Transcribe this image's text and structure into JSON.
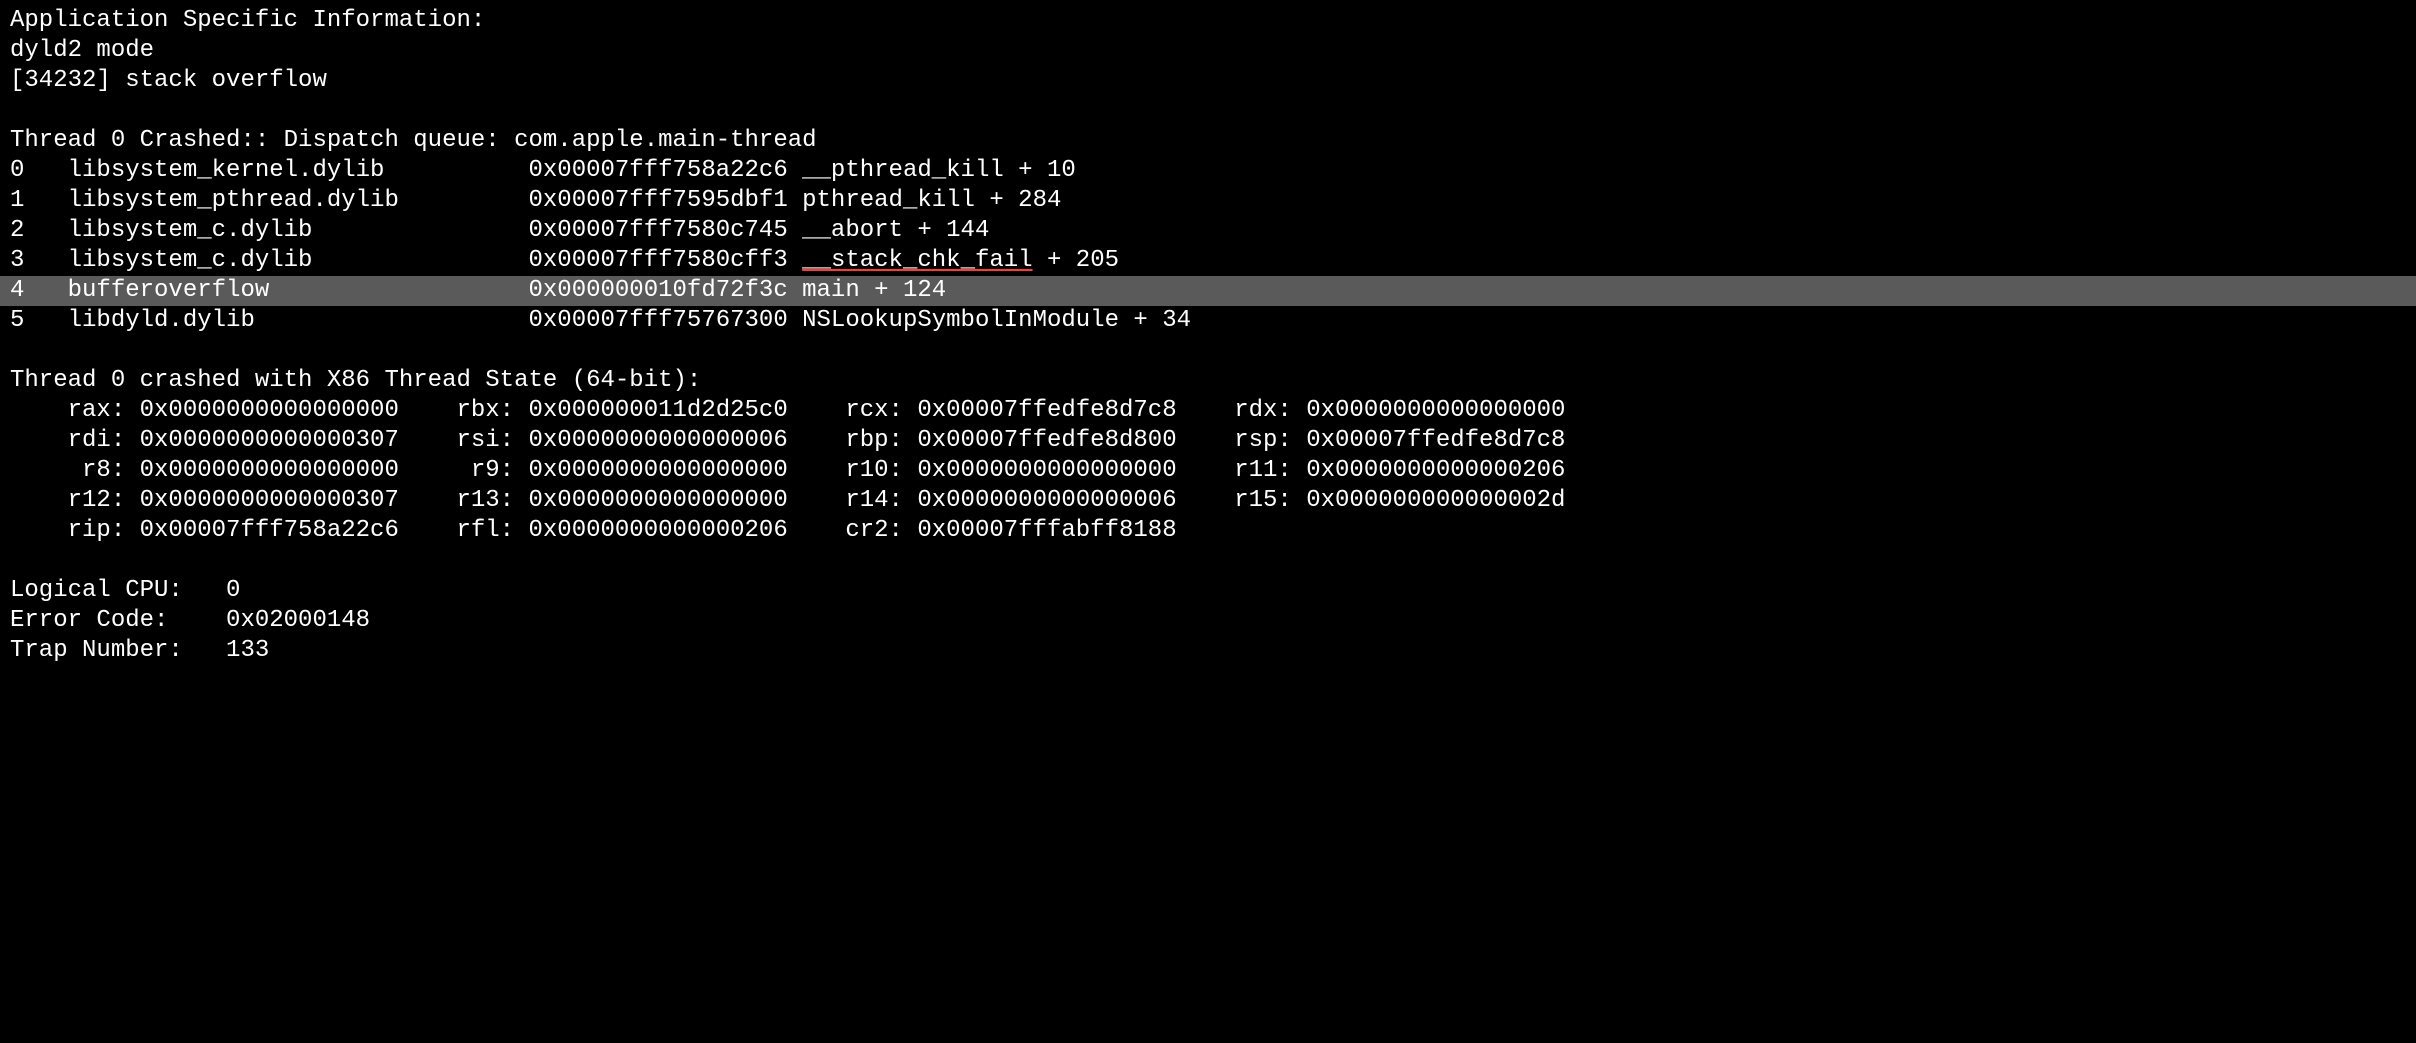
{
  "app_info": {
    "header": "Application Specific Information:",
    "lines": [
      "dyld2 mode",
      "[34232] stack overflow"
    ]
  },
  "thread_crashed": {
    "header": "Thread 0 Crashed:: Dispatch queue: com.apple.main-thread",
    "frames": [
      {
        "idx": "0",
        "module": "libsystem_kernel.dylib",
        "addr": "0x00007fff758a22c6",
        "sym": "__pthread_kill + 10",
        "underline": false,
        "highlight": false
      },
      {
        "idx": "1",
        "module": "libsystem_pthread.dylib",
        "addr": "0x00007fff7595dbf1",
        "sym": "pthread_kill + 284",
        "underline": false,
        "highlight": false
      },
      {
        "idx": "2",
        "module": "libsystem_c.dylib",
        "addr": "0x00007fff7580c745",
        "sym": "__abort + 144",
        "underline": false,
        "highlight": false
      },
      {
        "idx": "3",
        "module": "libsystem_c.dylib",
        "addr": "0x00007fff7580cff3",
        "sym": "__stack_chk_fail + 205",
        "underline": true,
        "highlight": false
      },
      {
        "idx": "4",
        "module": "bufferoverflow",
        "addr": "0x000000010fd72f3c",
        "sym": "main + 124",
        "underline": false,
        "highlight": true
      },
      {
        "idx": "5",
        "module": "libdyld.dylib",
        "addr": "0x00007fff75767300",
        "sym": "NSLookupSymbolInModule + 34",
        "underline": false,
        "highlight": false
      }
    ]
  },
  "thread_state": {
    "header": "Thread 0 crashed with X86 Thread State (64-bit):",
    "rows": [
      [
        {
          "reg": "rax",
          "val": "0x0000000000000000"
        },
        {
          "reg": "rbx",
          "val": "0x000000011d2d25c0"
        },
        {
          "reg": "rcx",
          "val": "0x00007ffedfe8d7c8"
        },
        {
          "reg": "rdx",
          "val": "0x0000000000000000"
        }
      ],
      [
        {
          "reg": "rdi",
          "val": "0x0000000000000307"
        },
        {
          "reg": "rsi",
          "val": "0x0000000000000006"
        },
        {
          "reg": "rbp",
          "val": "0x00007ffedfe8d800"
        },
        {
          "reg": "rsp",
          "val": "0x00007ffedfe8d7c8"
        }
      ],
      [
        {
          "reg": "r8",
          "val": "0x0000000000000000"
        },
        {
          "reg": "r9",
          "val": "0x0000000000000000"
        },
        {
          "reg": "r10",
          "val": "0x0000000000000000"
        },
        {
          "reg": "r11",
          "val": "0x0000000000000206"
        }
      ],
      [
        {
          "reg": "r12",
          "val": "0x0000000000000307"
        },
        {
          "reg": "r13",
          "val": "0x0000000000000000"
        },
        {
          "reg": "r14",
          "val": "0x0000000000000006"
        },
        {
          "reg": "r15",
          "val": "0x000000000000002d"
        }
      ],
      [
        {
          "reg": "rip",
          "val": "0x00007fff758a22c6"
        },
        {
          "reg": "rfl",
          "val": "0x0000000000000206"
        },
        {
          "reg": "cr2",
          "val": "0x00007fffabff8188"
        }
      ]
    ]
  },
  "footer": [
    {
      "label": "Logical CPU:",
      "value": "0"
    },
    {
      "label": "Error Code:",
      "value": "0x02000148"
    },
    {
      "label": "Trap Number:",
      "value": "133"
    }
  ],
  "underline_token": "__stack_chk_fail",
  "underline_suffix": " + 205"
}
